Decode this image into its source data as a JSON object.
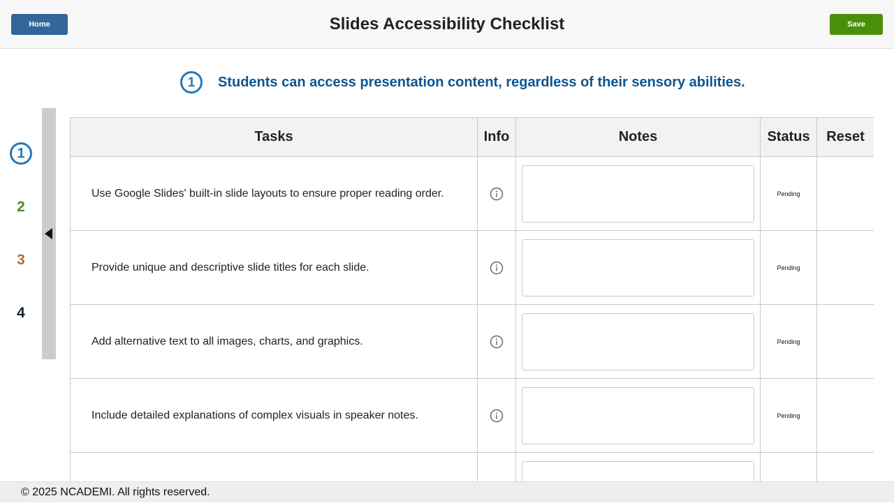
{
  "header": {
    "home_label": "Home",
    "title": "Slides Accessibility Checklist",
    "save_label": "Save"
  },
  "section": {
    "number": "1",
    "heading": "Students can access presentation content, regardless of their sensory abilities."
  },
  "nav": {
    "items": [
      {
        "label": "1",
        "color": "#2678b8",
        "active": true
      },
      {
        "label": "2",
        "color": "#4d8b2a",
        "active": false
      },
      {
        "label": "3",
        "color": "#b56a3a",
        "active": false
      },
      {
        "label": "4",
        "color": "#0f2236",
        "active": false
      }
    ]
  },
  "table": {
    "headers": {
      "tasks": "Tasks",
      "info": "Info",
      "notes": "Notes",
      "status": "Status",
      "reset": "Reset"
    },
    "rows": [
      {
        "task": "Use Google Slides' built-in slide layouts to ensure proper reading order.",
        "status": "Pending",
        "notes": ""
      },
      {
        "task": "Provide unique and descriptive slide titles for each slide.",
        "status": "Pending",
        "notes": ""
      },
      {
        "task": "Add alternative text to all images, charts, and graphics.",
        "status": "Pending",
        "notes": ""
      },
      {
        "task": "Include detailed explanations of complex visuals in speaker notes.",
        "status": "Pending",
        "notes": ""
      },
      {
        "task": "",
        "status": "",
        "notes": ""
      }
    ]
  },
  "footer": {
    "text": "© 2025 NCADEMI. All rights reserved."
  },
  "colors": {
    "home_button": "#336799",
    "save_button": "#4a8f0a",
    "accent": "#2678b8",
    "heading": "#0d5590"
  }
}
